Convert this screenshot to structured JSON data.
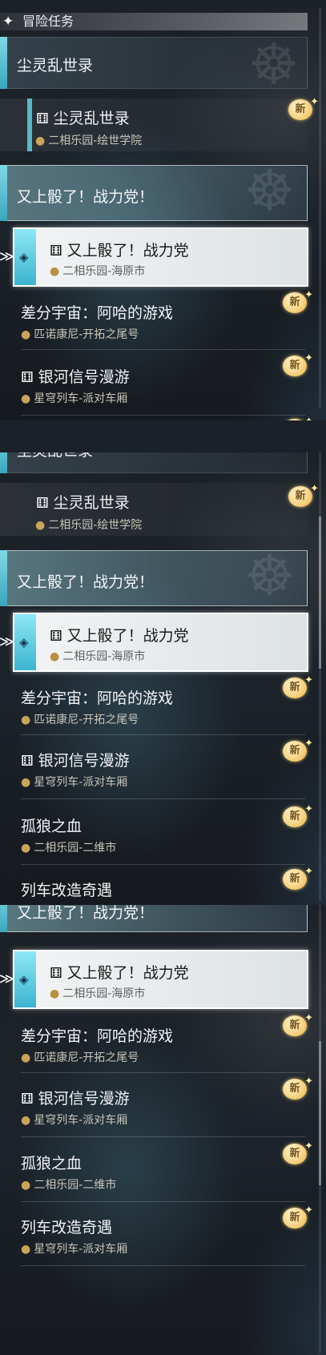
{
  "header": {
    "icon": "four-point-star-icon",
    "title": "冒险任务"
  },
  "categories": {
    "c1": {
      "title": "尘灵乱世录"
    },
    "c1_partial": {
      "title": "尘灵乱世录"
    },
    "c2": {
      "title": "又上骰了！战力党！"
    }
  },
  "quests": {
    "q1": {
      "title": "尘灵乱世录",
      "location": "二相乐园-绘世学院"
    },
    "q2": {
      "title": "又上骰了！战力党",
      "location": "二相乐园-海原市"
    },
    "q3": {
      "title": "差分宇宙：阿哈的游戏",
      "location": "匹诺康尼-开拓之尾号"
    },
    "q4": {
      "title": "银河信号漫游",
      "location": "星穹列车-派对车厢"
    },
    "q5": {
      "title": "孤狼之血",
      "location": "二相乐园-二维市"
    },
    "q6": {
      "title": "列车改造奇遇",
      "location": "星穹列车-派对车厢"
    }
  },
  "badge": {
    "label": "新",
    "color": "#f2c96c"
  },
  "colors": {
    "accent": "#58b9cc",
    "pin": "#c9a45a"
  }
}
